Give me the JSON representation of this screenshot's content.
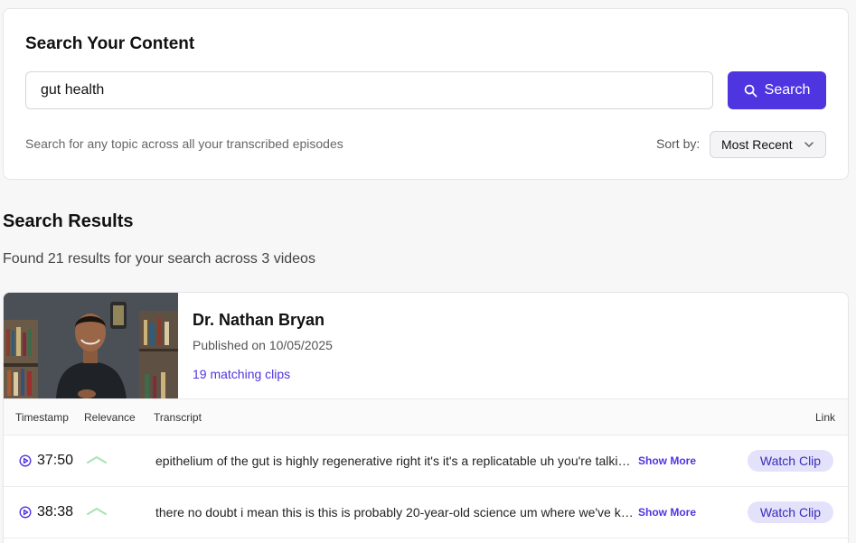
{
  "search": {
    "title": "Search Your Content",
    "query": "gut health",
    "button_label": "Search",
    "hint": "Search for any topic across all your transcribed episodes",
    "sort_label": "Sort by:",
    "sort_value": "Most Recent"
  },
  "results": {
    "title": "Search Results",
    "summary": "Found 21 results for your search across 3 videos"
  },
  "video": {
    "title": "Dr. Nathan Bryan",
    "published": "Published on 10/05/2025",
    "matching_clips": "19 matching clips",
    "columns": {
      "timestamp": "Timestamp",
      "relevance": "Relevance",
      "transcript": "Transcript",
      "link": "Link"
    },
    "rows": [
      {
        "timestamp": "37:50",
        "transcript": "epithelium of the gut is highly regenerative right it's it's a replicatable uh you're talking about the cells that line the gut",
        "show_more": "Show More",
        "watch": "Watch Clip"
      },
      {
        "timestamp": "38:38",
        "transcript": "there no doubt i mean this is this is probably 20-year-old science um where we've known this for a long time",
        "show_more": "Show More",
        "watch": "Watch Clip"
      }
    ]
  },
  "colors": {
    "accent": "#4f35e0",
    "relevance": "#a7e3b4",
    "watch_bg": "#e4e2fb"
  }
}
